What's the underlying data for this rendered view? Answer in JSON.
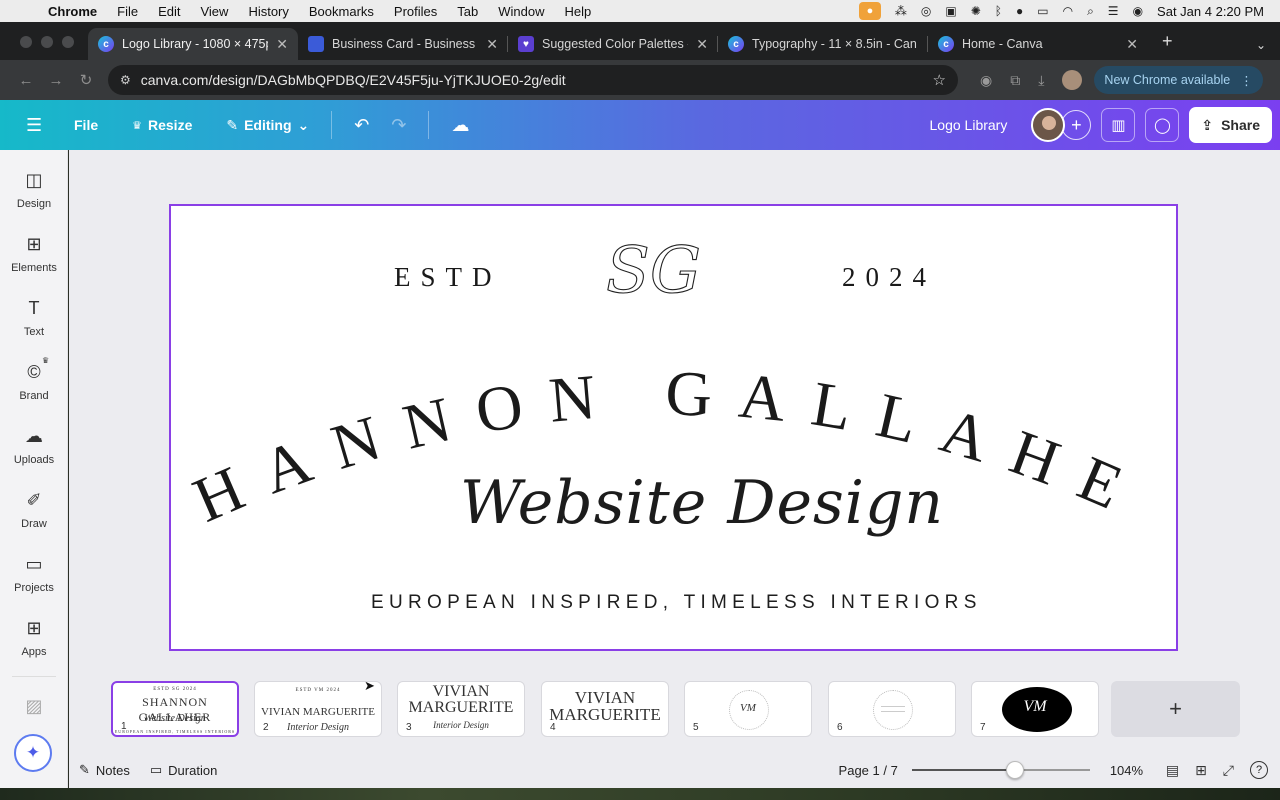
{
  "menubar": {
    "app": "Chrome",
    "items": [
      "File",
      "Edit",
      "View",
      "History",
      "Bookmarks",
      "Profiles",
      "Tab",
      "Window",
      "Help"
    ],
    "clock": "Sat Jan 4  2:20 PM"
  },
  "tabs": [
    {
      "title": "Logo Library - 1080 × 475px",
      "icon": "canva-icon",
      "active": true
    },
    {
      "title": "Business Card - Business Car",
      "icon": "business-card-icon",
      "active": false
    },
    {
      "title": "Suggested Color Palettes - 10",
      "icon": "heart-icon",
      "active": false
    },
    {
      "title": "Typography - 11 × 8.5in - Can",
      "icon": "canva-icon",
      "active": false
    },
    {
      "title": "Home - Canva",
      "icon": "canva-icon",
      "active": false
    }
  ],
  "address": {
    "url": "canva.com/design/DAGbMbQPDBQ/E2V45F5ju-YjTKJUOE0-2g/edit",
    "update_label": "New Chrome available"
  },
  "canva_header": {
    "file_label": "File",
    "resize_label": "Resize",
    "editing_label": "Editing",
    "project_name": "Logo Library",
    "share_label": "Share"
  },
  "rail": [
    {
      "label": "Design",
      "icon": "design-icon"
    },
    {
      "label": "Elements",
      "icon": "elements-icon"
    },
    {
      "label": "Text",
      "icon": "text-icon"
    },
    {
      "label": "Brand",
      "icon": "brand-icon"
    },
    {
      "label": "Uploads",
      "icon": "uploads-icon"
    },
    {
      "label": "Draw",
      "icon": "draw-icon"
    },
    {
      "label": "Projects",
      "icon": "projects-icon"
    },
    {
      "label": "Apps",
      "icon": "apps-icon"
    }
  ],
  "design": {
    "estd": "ESTD",
    "year": "2024",
    "monogram": "SG",
    "name": "SHANNON GALLAHER",
    "script": "Website Design",
    "tagline": "EUROPEAN INSPIRED, TIMELESS INTERIORS"
  },
  "thumbnails": [
    {
      "num": "1",
      "main": "SHANNON GALLAHER",
      "sub": "Website Design",
      "top": "ESTD  SG  2024",
      "small": "EUROPEAN INSPIRED, TIMELESS INTERIORS"
    },
    {
      "num": "2",
      "main": "VIVIAN MARGUERITE",
      "sub": "Interior Design",
      "top": "ESTD  VM  2024"
    },
    {
      "num": "3",
      "main": "VIVIAN",
      "main2": "MARGUERITE",
      "sub": "Interior Design"
    },
    {
      "num": "4",
      "main": "VIVIAN",
      "main2": "MARGUERITE"
    },
    {
      "num": "5",
      "main": "VM"
    },
    {
      "num": "6"
    },
    {
      "num": "7",
      "main": "VM"
    }
  ],
  "bottom": {
    "notes_label": "Notes",
    "duration_label": "Duration",
    "page_indicator": "Page 1 / 7",
    "zoom_label": "104%",
    "zoom_fraction": 0.58
  },
  "colors": {
    "accent_purple": "#8a3fe6",
    "header_start": "#16b9c9",
    "header_end": "#7b3ff0"
  }
}
